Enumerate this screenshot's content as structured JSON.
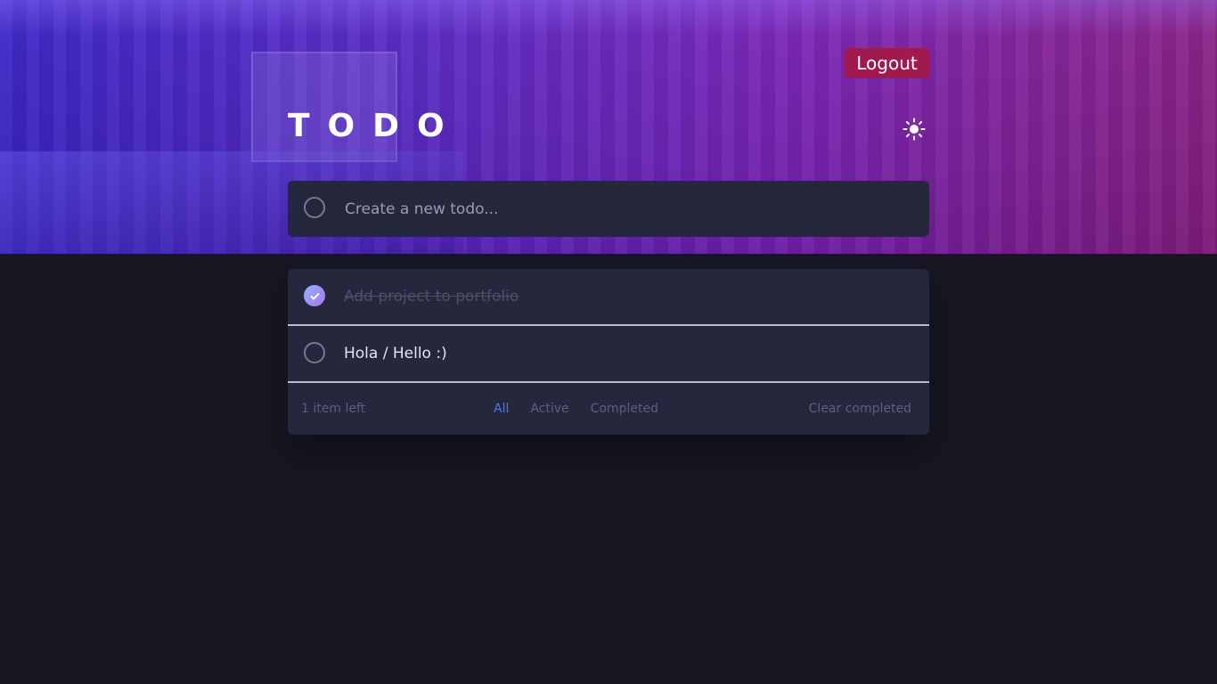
{
  "app": {
    "title": "TODO",
    "logout_label": "Logout",
    "theme_icon": "sun-icon"
  },
  "new_todo": {
    "placeholder": "Create a new todo..."
  },
  "todos": [
    {
      "text": "Add project to portfolio",
      "completed": true
    },
    {
      "text": "Hola / Hello :)",
      "completed": false
    }
  ],
  "footer": {
    "items_left": "1 item left",
    "filters": [
      "All",
      "Active",
      "Completed"
    ],
    "active_filter": "All",
    "clear_label": "Clear completed"
  },
  "colors": {
    "background": "#161722",
    "card": "#25273c",
    "accent": "#3a7cfd",
    "logout": "#a0194f",
    "check_gradient_start": "#8db4ff",
    "check_gradient_end": "#a875f0"
  }
}
